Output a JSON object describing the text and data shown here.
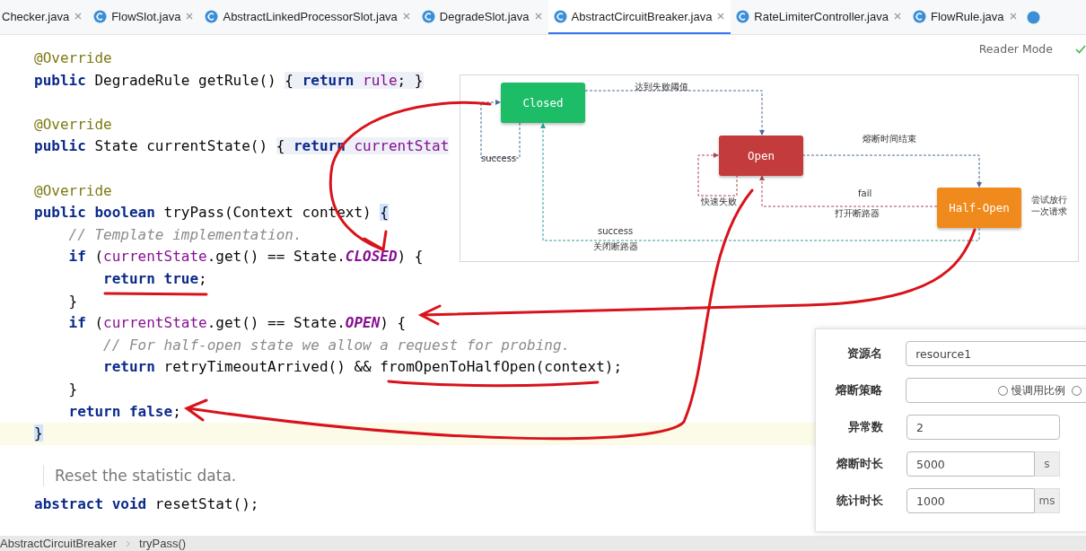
{
  "tabs": [
    {
      "label": "Checker.java",
      "icon": false,
      "selected": false
    },
    {
      "label": "FlowSlot.java",
      "icon": true,
      "selected": false
    },
    {
      "label": "AbstractLinkedProcessorSlot.java",
      "icon": true,
      "selected": false
    },
    {
      "label": "DegradeSlot.java",
      "icon": true,
      "selected": false
    },
    {
      "label": "AbstractCircuitBreaker.java",
      "icon": true,
      "selected": true
    },
    {
      "label": "RateLimiterController.java",
      "icon": true,
      "selected": false
    },
    {
      "label": "FlowRule.java",
      "icon": true,
      "selected": false
    }
  ],
  "reader_mode": "Reader Mode",
  "code": [
    {
      "current": false,
      "tokens": [
        {
          "text": "@Override",
          "kind": "ann"
        }
      ]
    },
    {
      "current": false,
      "tokens": [
        {
          "text": "public",
          "kind": "kw"
        },
        {
          "text": " DegradeRule getRule() ",
          "kind": "plain"
        },
        {
          "text": "{ ",
          "kind": "fold"
        },
        {
          "text": "return ",
          "kind": "fold-kw"
        },
        {
          "text": "rule",
          "kind": "fold-field"
        },
        {
          "text": "; }",
          "kind": "fold"
        }
      ]
    },
    {
      "current": false
    },
    {
      "current": false,
      "tokens": [
        {
          "text": "@Override",
          "kind": "ann"
        }
      ]
    },
    {
      "current": false,
      "tokens": [
        {
          "text": "public",
          "kind": "kw"
        },
        {
          "text": " State currentState() ",
          "kind": "plain"
        },
        {
          "text": "{ ",
          "kind": "fold"
        },
        {
          "text": "return ",
          "kind": "fold-kw"
        },
        {
          "text": "currentStat",
          "kind": "fold-field"
        }
      ]
    },
    {
      "current": false
    },
    {
      "current": false,
      "tokens": [
        {
          "text": "@Override",
          "kind": "ann"
        }
      ]
    },
    {
      "current": false,
      "tokens": [
        {
          "text": "public boolean",
          "kind": "kw"
        },
        {
          "text": " tryPass(Context context) ",
          "kind": "plain"
        },
        {
          "text": "{",
          "kind": "brace"
        }
      ]
    },
    {
      "current": false,
      "tokens": [
        {
          "text": "    // Template implementation.",
          "kind": "comment"
        }
      ]
    },
    {
      "current": false,
      "tokens": [
        {
          "text": "    if",
          "kind": "kw"
        },
        {
          "text": " (",
          "kind": "plain"
        },
        {
          "text": "currentState",
          "kind": "field"
        },
        {
          "text": ".get() == State.",
          "kind": "plain"
        },
        {
          "text": "CLOSED",
          "kind": "const"
        },
        {
          "text": ") {",
          "kind": "plain"
        }
      ]
    },
    {
      "current": false,
      "tokens": [
        {
          "text": "        return true",
          "kind": "kw"
        },
        {
          "text": ";",
          "kind": "plain"
        }
      ]
    },
    {
      "current": false,
      "tokens": [
        {
          "text": "    }",
          "kind": "plain"
        }
      ]
    },
    {
      "current": false,
      "tokens": [
        {
          "text": "    if",
          "kind": "kw"
        },
        {
          "text": " (",
          "kind": "plain"
        },
        {
          "text": "currentState",
          "kind": "field"
        },
        {
          "text": ".get() == State.",
          "kind": "plain"
        },
        {
          "text": "OPEN",
          "kind": "const"
        },
        {
          "text": ") {",
          "kind": "plain"
        }
      ]
    },
    {
      "current": false,
      "tokens": [
        {
          "text": "        // For half-open state we allow a request for probing.",
          "kind": "comment"
        }
      ]
    },
    {
      "current": false,
      "tokens": [
        {
          "text": "        return",
          "kind": "kw"
        },
        {
          "text": " retryTimeoutArrived() && fromOpenToHalfOpen(context);",
          "kind": "plain"
        }
      ]
    },
    {
      "current": false,
      "tokens": [
        {
          "text": "    }",
          "kind": "plain"
        }
      ]
    },
    {
      "current": false,
      "tokens": [
        {
          "text": "    return false",
          "kind": "kw"
        },
        {
          "text": ";",
          "kind": "plain"
        }
      ]
    },
    {
      "current": true,
      "tokens": [
        {
          "text": "}",
          "kind": "brace"
        }
      ]
    }
  ],
  "doc_comment": "Reset the statistic data.",
  "code_after": [
    {
      "text": "abstract void",
      "kind": "kw"
    },
    {
      "text": " resetStat();",
      "kind": "plain"
    }
  ],
  "diagram": {
    "nodes": [
      {
        "label": "Closed",
        "color": "#1dbd68"
      },
      {
        "label": "Open",
        "color": "#c43b3b"
      },
      {
        "label": "Half-Open",
        "color": "#f08a1c"
      }
    ],
    "labels": [
      "达到失败阈值",
      "success",
      "熔断时间结束",
      "fail",
      "快速失败",
      "打开断路器",
      "尝试放行一次请求",
      "success",
      "关闭断路器"
    ]
  },
  "form": [
    {
      "label": "资源名",
      "kind": "text",
      "value": "resource1"
    },
    {
      "label": "熔断策略",
      "kind": "radio",
      "options": [
        {
          "label": "慢调用比例",
          "selected": false
        },
        {
          "selected": false
        }
      ]
    },
    {
      "label": "异常数",
      "kind": "short",
      "value": "2"
    },
    {
      "label": "熔断时长",
      "kind": "unit",
      "value": "5000",
      "unit": "s"
    },
    {
      "label": "统计时长",
      "kind": "unit",
      "value": "1000",
      "unit": "ms"
    }
  ],
  "breadcrumb": [
    "AbstractCircuitBreaker",
    "tryPass()"
  ]
}
